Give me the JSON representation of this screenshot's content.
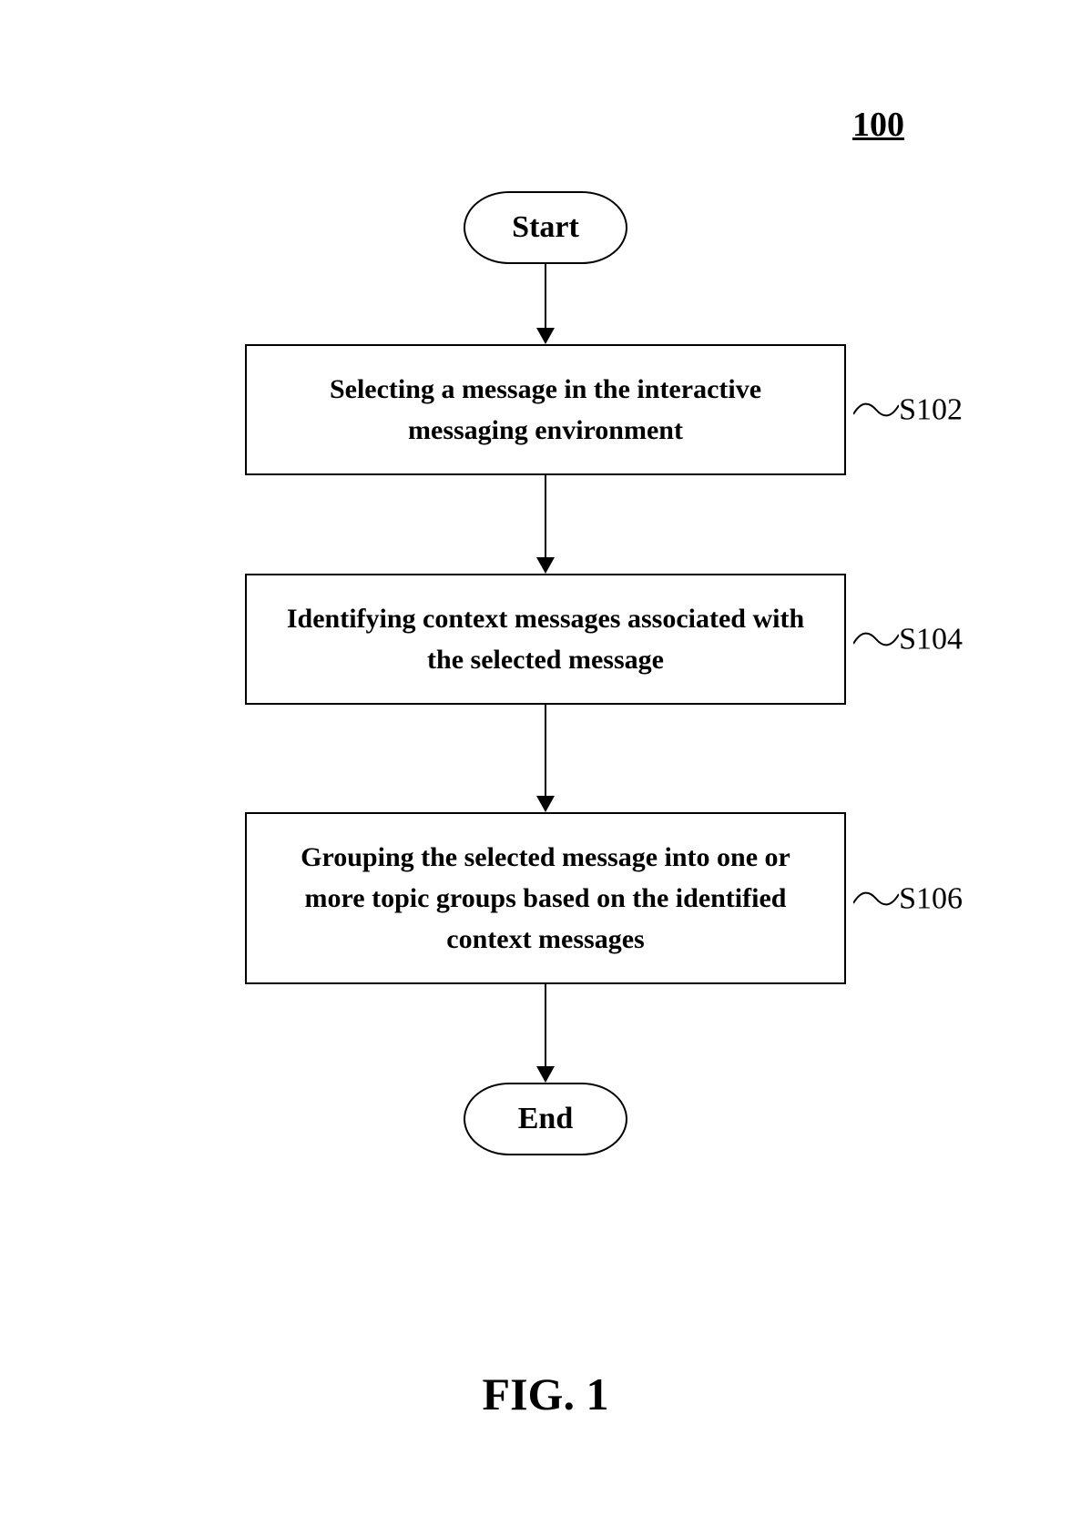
{
  "figure_number": "100",
  "flowchart": {
    "start": "Start",
    "end": "End",
    "steps": [
      {
        "text": "Selecting a message in the interactive messaging environment",
        "label": "S102"
      },
      {
        "text": "Identifying context messages associated with the selected message",
        "label": "S104"
      },
      {
        "text": "Grouping the selected message into one or more topic groups based on the identified context messages",
        "label": "S106"
      }
    ]
  },
  "caption": "FIG. 1"
}
